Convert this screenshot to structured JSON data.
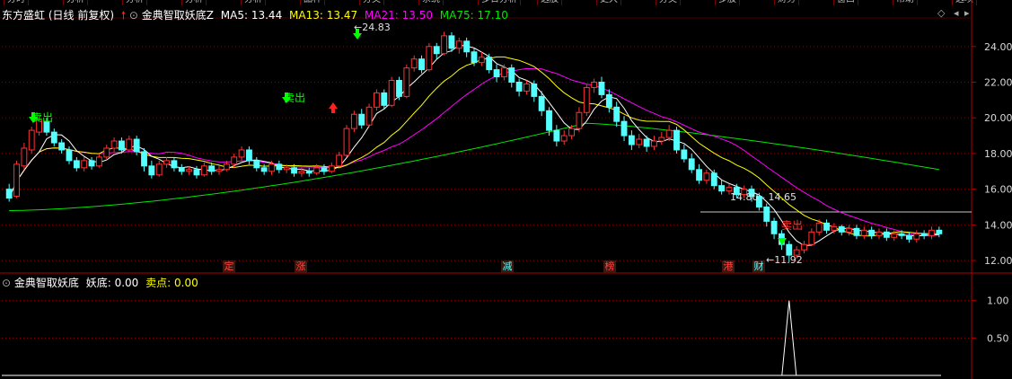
{
  "header": {
    "symbol": "东方盛虹",
    "period": "(日线 前复权)",
    "indicator_name": "金典智取妖底Z",
    "ma5": "MA5: 13.44",
    "ma13": "MA13: 13.47",
    "ma21": "MA21: 13.50",
    "ma75": "MA75: 17.10"
  },
  "sub_header": {
    "name": "金典智取妖底",
    "yaodi": "妖底: 0.00",
    "maidian": "卖点: 0.00"
  },
  "controls": {
    "diamond": "◇",
    "icon_left": "◂",
    "icon_right": "▸"
  },
  "top_tabs": [
    "分时",
    "分析",
    "分析",
    "分析",
    "分析",
    "品种",
    "分类",
    "系统",
    "多日分析",
    "选股",
    "更大",
    "分类",
    "多股",
    "财务",
    "窗口",
    "帮助",
    "选项"
  ],
  "colors": {
    "up": "#ff3232",
    "down": "#54ffff",
    "ma5": "#ffffff",
    "ma13": "#ffff00",
    "ma21": "#ff00ff",
    "ma75": "#00e600",
    "grid": "#8b0000",
    "signal": "#00ff00"
  },
  "events": [
    {
      "text": "定",
      "color": "#ff4040"
    },
    {
      "text": "涨",
      "color": "#ff4040"
    },
    {
      "text": "减",
      "color": "#54ffff"
    },
    {
      "text": "榜",
      "color": "#ff4040"
    },
    {
      "text": "港",
      "color": "#ff4040"
    },
    {
      "text": "财",
      "color": "#54ffff"
    }
  ],
  "annotations": {
    "high": "24.83",
    "low": "11.92",
    "range": "14.80 - 14.65",
    "sell1": "卖出",
    "sell2": "卖出",
    "right_label": "卖出"
  },
  "chart_data": [
    {
      "type": "candlestick",
      "title": "东方盛虹 日线 前复权",
      "ylim": [
        11.5,
        25.5
      ],
      "yticks": [
        12.0,
        14.0,
        16.0,
        18.0,
        20.0,
        22.0,
        24.0
      ],
      "grid": true,
      "series": [
        {
          "name": "MA5",
          "value": 13.44
        },
        {
          "name": "MA13",
          "value": 13.47
        },
        {
          "name": "MA21",
          "value": 13.5
        },
        {
          "name": "MA75",
          "value": 17.1
        }
      ],
      "ohlc": [
        [
          16.0,
          15.5,
          16.3,
          15.3
        ],
        [
          15.6,
          17.4,
          17.6,
          15.5
        ],
        [
          17.3,
          18.3,
          18.6,
          17.1
        ],
        [
          18.2,
          19.3,
          19.5,
          18.0
        ],
        [
          19.2,
          19.9,
          20.1,
          19.0
        ],
        [
          19.8,
          19.2,
          20.0,
          19.0
        ],
        [
          19.2,
          18.6,
          19.4,
          18.4
        ],
        [
          18.6,
          18.2,
          18.8,
          18.0
        ],
        [
          18.2,
          17.6,
          18.4,
          17.4
        ],
        [
          17.6,
          17.2,
          17.8,
          17.0
        ],
        [
          17.2,
          17.6,
          17.8,
          17.0
        ],
        [
          17.6,
          17.3,
          17.8,
          17.1
        ],
        [
          17.3,
          17.8,
          18.0,
          17.2
        ],
        [
          17.8,
          18.3,
          18.5,
          17.7
        ],
        [
          18.3,
          18.7,
          18.9,
          18.1
        ],
        [
          18.7,
          18.2,
          18.9,
          18.0
        ],
        [
          18.2,
          18.8,
          19.0,
          18.1
        ],
        [
          18.8,
          18.1,
          19.0,
          17.9
        ],
        [
          18.1,
          17.3,
          18.3,
          17.0
        ],
        [
          17.3,
          16.8,
          17.6,
          16.6
        ],
        [
          16.8,
          17.4,
          17.6,
          16.7
        ],
        [
          17.4,
          17.6,
          17.8,
          17.2
        ],
        [
          17.6,
          17.2,
          17.8,
          17.0
        ],
        [
          17.2,
          17.0,
          17.4,
          16.8
        ],
        [
          17.0,
          17.1,
          17.3,
          16.8
        ],
        [
          17.1,
          16.8,
          17.3,
          16.6
        ],
        [
          16.8,
          17.3,
          17.5,
          16.7
        ],
        [
          17.3,
          17.0,
          17.5,
          16.8
        ],
        [
          17.0,
          17.1,
          17.3,
          16.8
        ],
        [
          17.1,
          17.4,
          17.6,
          17.0
        ],
        [
          17.4,
          17.8,
          18.0,
          17.2
        ],
        [
          17.8,
          18.2,
          18.4,
          17.6
        ],
        [
          18.2,
          17.6,
          18.4,
          17.4
        ],
        [
          17.6,
          17.2,
          17.8,
          17.0
        ],
        [
          17.2,
          17.0,
          17.4,
          16.8
        ],
        [
          17.0,
          17.4,
          17.6,
          16.8
        ],
        [
          17.4,
          17.1,
          17.6,
          16.9
        ],
        [
          17.1,
          17.2,
          17.4,
          16.9
        ],
        [
          17.2,
          16.9,
          17.4,
          16.7
        ],
        [
          16.9,
          17.0,
          17.2,
          16.7
        ],
        [
          17.0,
          16.9,
          17.2,
          16.7
        ],
        [
          16.9,
          17.2,
          17.4,
          16.8
        ],
        [
          17.2,
          17.0,
          17.4,
          16.8
        ],
        [
          17.0,
          17.3,
          17.5,
          16.9
        ],
        [
          17.3,
          17.9,
          18.1,
          17.2
        ],
        [
          17.9,
          19.4,
          19.6,
          17.8
        ],
        [
          19.4,
          20.2,
          20.4,
          19.2
        ],
        [
          20.2,
          19.6,
          20.5,
          19.4
        ],
        [
          19.6,
          20.6,
          20.8,
          19.5
        ],
        [
          20.6,
          21.4,
          21.6,
          20.4
        ],
        [
          21.4,
          20.7,
          21.6,
          20.5
        ],
        [
          20.7,
          22.1,
          22.3,
          20.6
        ],
        [
          22.1,
          21.2,
          22.3,
          21.0
        ],
        [
          21.2,
          22.8,
          23.0,
          21.1
        ],
        [
          22.8,
          23.3,
          23.5,
          22.6
        ],
        [
          23.3,
          22.7,
          23.5,
          22.5
        ],
        [
          22.7,
          24.0,
          24.2,
          22.6
        ],
        [
          24.0,
          23.6,
          24.2,
          23.3
        ],
        [
          23.6,
          24.6,
          24.83,
          23.5
        ],
        [
          24.6,
          23.9,
          24.8,
          23.7
        ],
        [
          23.9,
          24.3,
          24.5,
          23.6
        ],
        [
          24.3,
          23.7,
          24.5,
          23.4
        ],
        [
          23.7,
          23.1,
          23.9,
          22.9
        ],
        [
          23.1,
          23.4,
          23.7,
          22.9
        ],
        [
          23.4,
          22.7,
          23.6,
          22.5
        ],
        [
          22.7,
          22.3,
          23.0,
          22.0
        ],
        [
          22.3,
          22.8,
          23.0,
          22.1
        ],
        [
          22.8,
          22.0,
          23.0,
          21.7
        ],
        [
          22.0,
          21.5,
          22.2,
          21.2
        ],
        [
          21.5,
          21.9,
          22.1,
          21.3
        ],
        [
          21.9,
          21.2,
          22.1,
          20.9
        ],
        [
          21.2,
          20.4,
          21.5,
          20.1
        ],
        [
          20.4,
          19.3,
          20.6,
          19.0
        ],
        [
          19.3,
          18.7,
          19.6,
          18.4
        ],
        [
          18.7,
          19.0,
          19.3,
          18.5
        ],
        [
          19.0,
          19.4,
          19.6,
          18.8
        ],
        [
          19.4,
          20.3,
          20.6,
          19.2
        ],
        [
          20.3,
          21.7,
          21.9,
          20.1
        ],
        [
          21.7,
          22.0,
          22.2,
          21.4
        ],
        [
          22.0,
          21.3,
          22.3,
          21.1
        ],
        [
          21.3,
          20.6,
          21.6,
          20.3
        ],
        [
          20.6,
          19.8,
          20.9,
          19.5
        ],
        [
          19.8,
          19.0,
          20.1,
          18.7
        ],
        [
          19.0,
          18.5,
          19.3,
          18.2
        ],
        [
          18.5,
          18.8,
          19.1,
          18.3
        ],
        [
          18.8,
          18.4,
          19.0,
          18.1
        ],
        [
          18.4,
          18.7,
          19.0,
          18.2
        ],
        [
          18.7,
          18.9,
          19.2,
          18.5
        ],
        [
          18.9,
          19.3,
          19.6,
          18.7
        ],
        [
          19.3,
          18.2,
          19.5,
          18.0
        ],
        [
          18.2,
          17.7,
          18.5,
          17.5
        ],
        [
          17.7,
          17.1,
          18.0,
          16.9
        ],
        [
          17.1,
          16.5,
          17.4,
          16.3
        ],
        [
          16.5,
          16.9,
          17.1,
          16.3
        ],
        [
          16.9,
          16.2,
          17.1,
          16.0
        ],
        [
          16.2,
          15.9,
          16.5,
          15.7
        ],
        [
          15.9,
          16.1,
          16.3,
          15.7
        ],
        [
          16.1,
          15.7,
          16.3,
          15.5
        ],
        [
          15.7,
          16.0,
          16.2,
          15.5
        ],
        [
          16.0,
          15.6,
          16.2,
          15.3
        ],
        [
          15.6,
          15.0,
          15.8,
          14.8
        ],
        [
          15.0,
          14.2,
          15.2,
          13.9
        ],
        [
          14.2,
          13.5,
          14.4,
          13.2
        ],
        [
          13.5,
          12.9,
          13.7,
          12.6
        ],
        [
          12.9,
          12.3,
          13.1,
          11.92
        ],
        [
          12.3,
          12.6,
          12.8,
          12.1
        ],
        [
          12.6,
          12.9,
          13.1,
          12.4
        ],
        [
          12.9,
          13.6,
          13.8,
          12.8
        ],
        [
          13.6,
          14.1,
          14.3,
          13.4
        ],
        [
          14.1,
          13.7,
          14.3,
          13.5
        ],
        [
          13.7,
          13.9,
          14.1,
          13.5
        ],
        [
          13.9,
          13.6,
          14.0,
          13.4
        ],
        [
          13.6,
          13.8,
          14.0,
          13.4
        ],
        [
          13.8,
          13.4,
          14.0,
          13.2
        ],
        [
          13.4,
          13.7,
          13.9,
          13.2
        ],
        [
          13.7,
          13.4,
          13.9,
          13.2
        ],
        [
          13.4,
          13.6,
          13.8,
          13.2
        ],
        [
          13.6,
          13.3,
          13.8,
          13.1
        ],
        [
          13.3,
          13.5,
          13.7,
          13.1
        ],
        [
          13.5,
          13.4,
          13.7,
          13.2
        ],
        [
          13.4,
          13.2,
          13.6,
          13.0
        ],
        [
          13.2,
          13.5,
          13.7,
          13.0
        ],
        [
          13.5,
          13.4,
          13.7,
          13.2
        ],
        [
          13.4,
          13.7,
          13.9,
          13.2
        ],
        [
          13.7,
          13.5,
          13.9,
          13.3
        ]
      ]
    },
    {
      "type": "line",
      "title": "金典智取妖底",
      "ylim": [
        0,
        1.2
      ],
      "yticks": [
        0.5,
        1.0
      ],
      "series": [
        {
          "name": "妖底",
          "spike_index": 104,
          "value": 1.0
        }
      ]
    }
  ]
}
